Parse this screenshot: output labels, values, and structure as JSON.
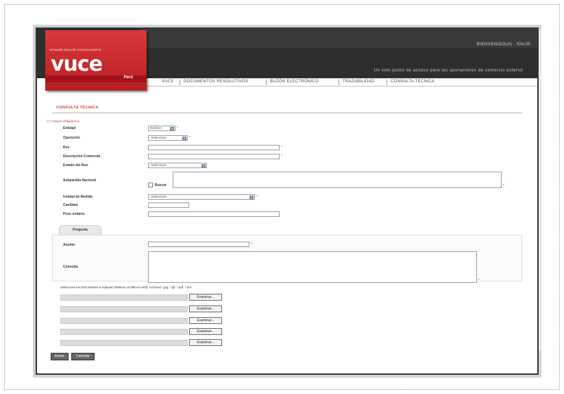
{
  "header": {
    "user_links": "BIENVENIDO(A) · SALIR",
    "tagline": "Un solo punto de acceso para las operaciones de comercio exterior",
    "logo": {
      "tagline": "Ventanilla Única de Comercio Exterior",
      "word": "vuce",
      "sub": "Perú"
    }
  },
  "nav": {
    "items": [
      "VUCE",
      "DOCUMENTOS RESOLUTIVOS",
      "BUZÓN ELECTRÓNICO",
      "TRAZABILIDAD",
      "CONSULTA TÉCNICA"
    ]
  },
  "page": {
    "title": "CONSULTA TÉCNICA",
    "legend": "(*) Campos Obligatorios"
  },
  "form": {
    "entidad_label": "Entidad",
    "entidad_value": "DIGESA",
    "operacion_label": "Operación",
    "operacion_value": "-Seleccione-",
    "ruc_label": "Rso",
    "desc_label": "Descripción Comercial",
    "estado_label": "Estado del Ruo",
    "estado_value": "-Seleccione-",
    "subpartida_label": "Subpartida Nacional",
    "buscar_label": "Buscar",
    "unidad_label": "Unidad de Medida",
    "unidad_value": "-Seleccione-",
    "cantidad_label": "Cantidad",
    "peso_label": "Peso unitario"
  },
  "question": {
    "tab_label": "Pregunta",
    "asunto_label": "Asunto",
    "consulta_label": "Consulta",
    "attach_hint": "Seleccione los Documentos a Adjuntar (Máximo 10 MB en total). Archivos *.jpg, *.gif, *.pdf, *.doc"
  },
  "files": {
    "button_label": "Examinar..."
  },
  "actions": {
    "send": "Enviar",
    "cancel": "Cancelar"
  },
  "colors": {
    "header_bg": "#2e2e2e",
    "logo_red": "#c8282c",
    "title_red": "#c04040",
    "button_gray": "#666666"
  }
}
